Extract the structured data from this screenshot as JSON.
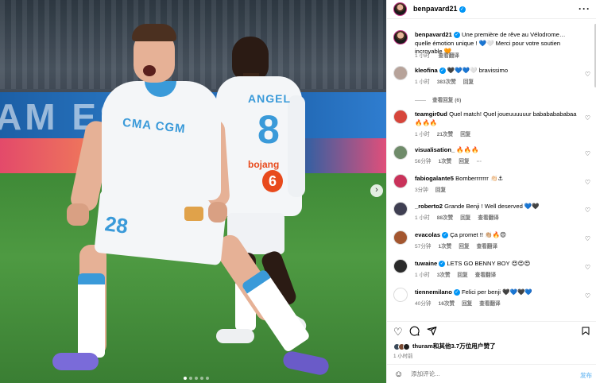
{
  "photo": {
    "banner_text": "AM  ES",
    "p2_name": "ANGEL",
    "p2_number": "8",
    "p2_sponsor": "bojang",
    "p2_logo": "6",
    "p1_sponsor": "CMA CGM",
    "p1_number": "28",
    "next_icon": "›",
    "slides": 5,
    "active_slide": 0
  },
  "header": {
    "username": "benpavard21",
    "more_label": "···"
  },
  "caption": {
    "username": "benpavard21",
    "text": "Une première de rêve au Vélodrome… quelle émotion unique ! 💙🤍 Merci pour votre soutien incroyable 🧡",
    "time": "1 小时",
    "translate": "查看翻译"
  },
  "comments": [
    {
      "username": "kleofina",
      "verified": true,
      "text": "🖤💙💙🤍 bravissimo",
      "time": "1 小时",
      "likes": "383次赞",
      "reply": "回复",
      "replies": "查看回复 (6)",
      "avatar_color": "#b7a39a"
    },
    {
      "username": "teamgir0ud",
      "verified": false,
      "text": "Quel match! Quel joueuuuuuur babababababaa 🔥🔥🔥",
      "time": "1 小时",
      "likes": "21次赞",
      "reply": "回复",
      "avatar_color": "#d6453b"
    },
    {
      "username": "visualisation_",
      "verified": false,
      "text": "🔥🔥🔥",
      "time": "56分钟",
      "likes": "1次赞",
      "reply": "回复",
      "extra": "···",
      "avatar_color": "#6f8b6a"
    },
    {
      "username": "fabiogalante5",
      "verified": false,
      "text": "Bomberrrrrrr 👏🏻⚓",
      "time": "3分钟",
      "reply": "回复",
      "avatar_color": "#c9325a"
    },
    {
      "username": "_roberto2",
      "verified": false,
      "text": "Grande Benji ! Well deserved 💙🖤",
      "time": "1 小时",
      "likes": "88次赞",
      "reply": "回复",
      "translate": "查看翻译",
      "avatar_color": "#3f3f52"
    },
    {
      "username": "evacolas",
      "verified": true,
      "text": "Ça promet !! 👏🏼🔥😍",
      "time": "57分钟",
      "likes": "1次赞",
      "reply": "回复",
      "translate": "查看翻译",
      "avatar_color": "#a3562f"
    },
    {
      "username": "tuwaine",
      "verified": true,
      "text": "LETS GO BENNY BOY 😍😍😍",
      "time": "1 小时",
      "likes": "3次赞",
      "reply": "回复",
      "translate": "查看翻译",
      "avatar_color": "#2a2a2a"
    },
    {
      "username": "tiennemilano",
      "verified": true,
      "text": "Felici per benji 🖤💙🖤💙",
      "time": "40分钟",
      "likes": "16次赞",
      "reply": "回复",
      "translate": "查看翻译",
      "avatar_color": "#ffffff"
    }
  ],
  "actions": {
    "like_icon": "heart-outline-icon",
    "comment_icon": "comment-icon",
    "share_icon": "share-icon",
    "save_icon": "bookmark-icon"
  },
  "likes": {
    "user": "thuram",
    "text": "和其他3.7万位用户赞了"
  },
  "time_ago": "1 小时前",
  "add_comment": {
    "placeholder": "添加评论...",
    "post_label": "发布"
  },
  "colors": {
    "accent": "#0095f6",
    "muted": "#737373",
    "om_blue": "#3a9ad9"
  }
}
